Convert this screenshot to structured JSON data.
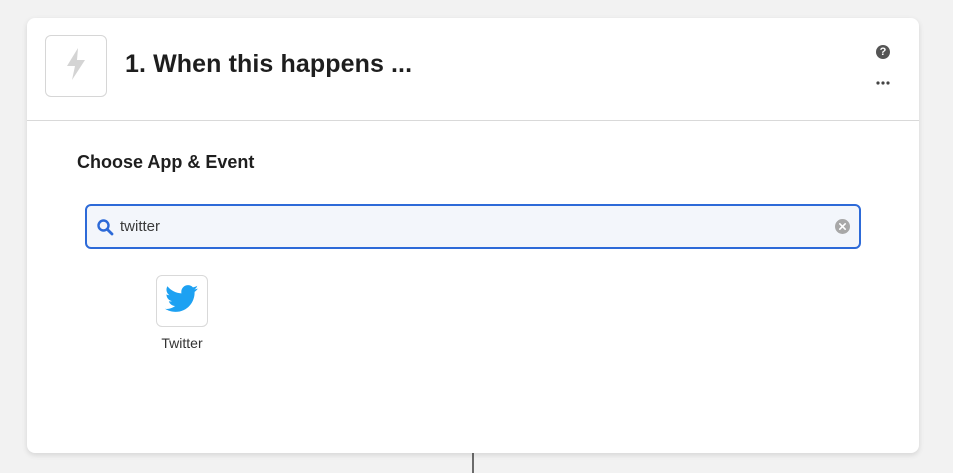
{
  "step": {
    "title": "1. When this happens ...",
    "trigger_icon": "lightning-bolt-icon"
  },
  "header_actions": {
    "help_icon": "question-circle-icon",
    "help_glyph": "?",
    "more_icon": "ellipsis-icon"
  },
  "section": {
    "title": "Choose App & Event"
  },
  "search": {
    "value": "twitter",
    "icon": "search-icon",
    "clear_icon": "clear-icon"
  },
  "results": [
    {
      "label": "Twitter",
      "icon": "twitter-bird-icon"
    }
  ],
  "colors": {
    "focus_border": "#2d6ad8",
    "twitter_blue": "#1da1f2"
  }
}
